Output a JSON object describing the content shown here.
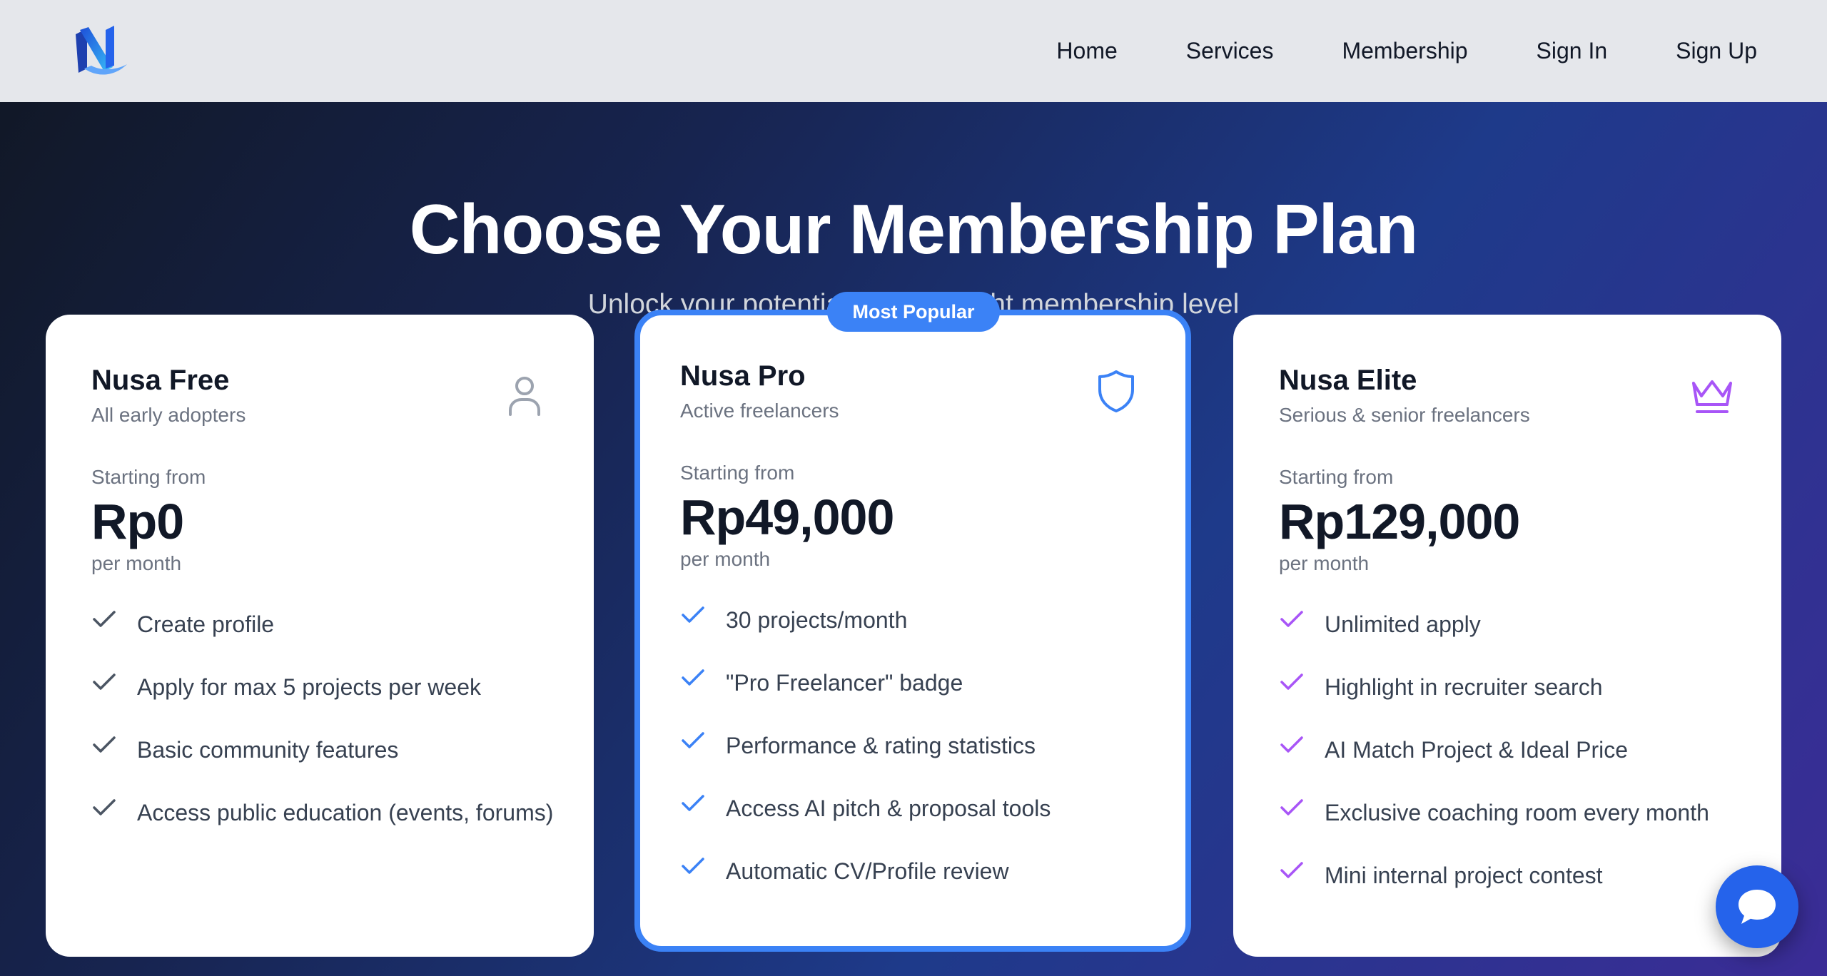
{
  "nav": {
    "links": [
      "Home",
      "Services",
      "Membership",
      "Sign In",
      "Sign Up"
    ]
  },
  "hero": {
    "title": "Choose Your Membership Plan",
    "subtitle": "Unlock your potential with the right membership level"
  },
  "badge": "Most Popular",
  "plans": [
    {
      "name": "Nusa Free",
      "tagline": "All early adopters",
      "icon": "user-icon",
      "starting_label": "Starting from",
      "price": "Rp0",
      "period": "per month",
      "check_color": "#4b5563",
      "features": [
        "Create profile",
        "Apply for max 5 projects per week",
        "Basic community features",
        "Access public education (events, forums)"
      ]
    },
    {
      "name": "Nusa Pro",
      "tagline": "Active freelancers",
      "icon": "shield-icon",
      "starting_label": "Starting from",
      "price": "Rp49,000",
      "period": "per month",
      "check_color": "#3b82f6",
      "features": [
        "30 projects/month",
        "\"Pro Freelancer\" badge",
        "Performance & rating statistics",
        "Access AI pitch & proposal tools",
        "Automatic CV/Profile review"
      ]
    },
    {
      "name": "Nusa Elite",
      "tagline": "Serious & senior freelancers",
      "icon": "crown-icon",
      "starting_label": "Starting from",
      "price": "Rp129,000",
      "period": "per month",
      "check_color": "#a855f7",
      "features": [
        "Unlimited apply",
        "Highlight in recruiter search",
        "AI Match Project & Ideal Price",
        "Exclusive coaching room every month",
        "Mini internal project contest"
      ]
    }
  ],
  "colors": {
    "accent": "#3b82f6",
    "elite": "#a855f7",
    "chat": "#2563eb"
  }
}
